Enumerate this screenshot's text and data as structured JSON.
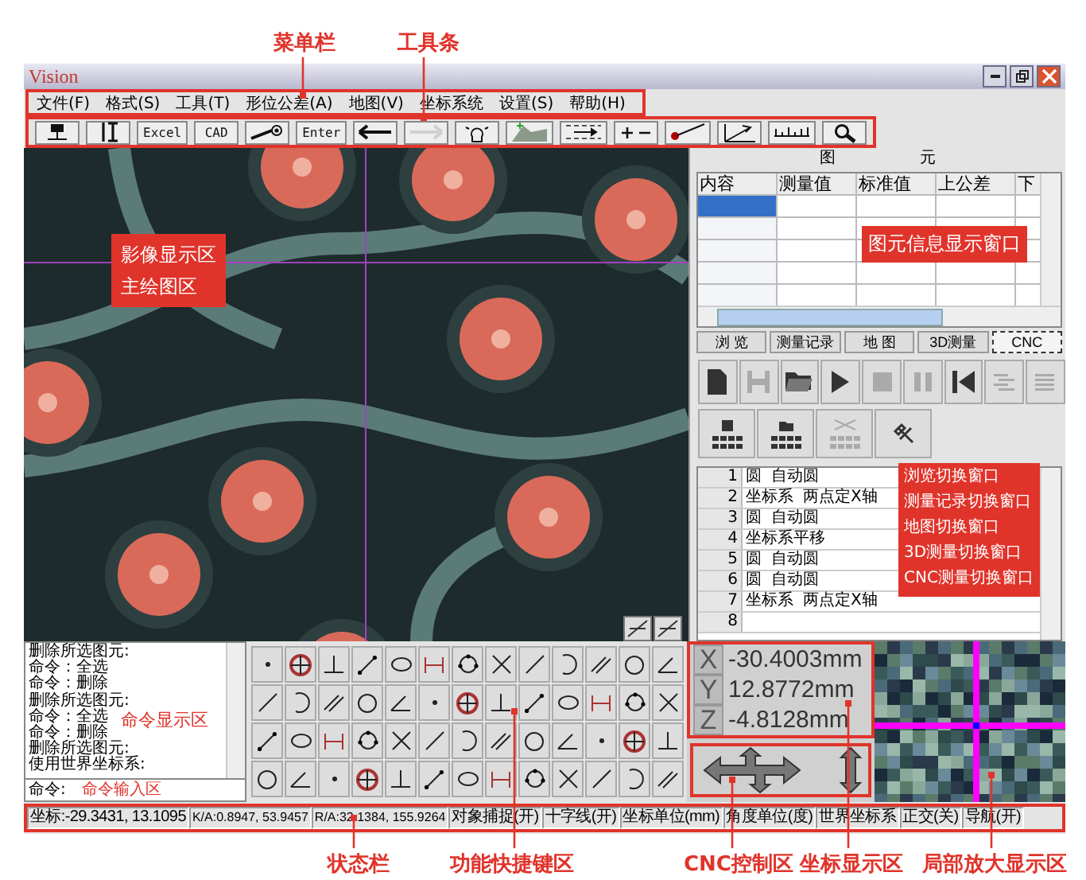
{
  "window": {
    "title": "Vision"
  },
  "menu_bar": {
    "items": [
      "文件(F)",
      "格式(S)",
      "工具(T)",
      "形位公差(A)",
      "地图(V)",
      "坐标系统",
      "设置(S)",
      "帮助(H)"
    ]
  },
  "toolbar": {
    "items": [
      {
        "kind": "icon",
        "disabled": false
      },
      {
        "kind": "icon",
        "disabled": false
      },
      {
        "kind": "text",
        "label": "Excel",
        "disabled": false
      },
      {
        "kind": "text",
        "label": "CAD",
        "disabled": false
      },
      {
        "kind": "icon",
        "disabled": false
      },
      {
        "kind": "text",
        "label": "Enter",
        "disabled": false
      },
      {
        "kind": "icon",
        "disabled": false
      },
      {
        "kind": "icon",
        "disabled": true
      },
      {
        "kind": "icon",
        "disabled": false
      },
      {
        "kind": "icon",
        "disabled": false
      },
      {
        "kind": "icon",
        "disabled": false
      },
      {
        "kind": "icon",
        "disabled": false
      },
      {
        "kind": "icon",
        "disabled": false
      },
      {
        "kind": "icon",
        "disabled": false
      },
      {
        "kind": "icon",
        "disabled": false
      },
      {
        "kind": "icon",
        "disabled": false
      }
    ]
  },
  "image_view": {
    "label_lines": [
      "影像显示区",
      "主绘图区"
    ]
  },
  "element_panel": {
    "title": "图 元",
    "columns": [
      "内容",
      "测量值",
      "标准值",
      "上公差",
      "下"
    ],
    "rows": [
      {
        "selected": true
      },
      {
        "selected": false
      },
      {
        "selected": false
      },
      {
        "selected": false
      },
      {
        "selected": false
      }
    ],
    "label": "图元信息显示窗口"
  },
  "tabs": [
    {
      "label": "浏 览",
      "selected": false
    },
    {
      "label": "测量记录",
      "selected": false
    },
    {
      "label": "地 图",
      "selected": false
    },
    {
      "label": "3D测量",
      "selected": false
    },
    {
      "label": "CNC",
      "selected": true
    }
  ],
  "tab_tools": [
    {
      "disabled": false
    },
    {
      "disabled": true
    },
    {
      "disabled": false
    },
    {
      "disabled": false
    },
    {
      "disabled": true
    },
    {
      "disabled": true
    },
    {
      "disabled": false
    },
    {
      "disabled": true
    },
    {
      "disabled": true
    }
  ],
  "tab_tools_2": [
    {
      "disabled": false
    },
    {
      "disabled": false
    },
    {
      "disabled": true
    },
    {
      "disabled": false
    }
  ],
  "records": [
    {
      "number": "1",
      "type": "圆",
      "name": "自动圆"
    },
    {
      "number": "2",
      "type": "坐标系",
      "name": "两点定X轴"
    },
    {
      "number": "3",
      "type": "圆",
      "name": "自动圆"
    },
    {
      "number": "4",
      "type": "坐标系平移"
    },
    {
      "number": "5",
      "type": "圆",
      "name": "自动圆"
    },
    {
      "number": "6",
      "type": "圆",
      "name": "自动圆"
    },
    {
      "number": "7",
      "type": "坐标系",
      "name": "两点定X轴"
    },
    {
      "number": "8"
    }
  ],
  "records_label_lines": [
    "浏览切换窗口",
    "测量记录切换窗口",
    "地图切换窗口",
    "3D测量切换窗口",
    "CNC测量切换窗口"
  ],
  "command": {
    "lines": [
      "删除所选图元:",
      "命令：全选",
      "命令：删除",
      "删除所选图元:",
      "命令：全选",
      "命令：删除",
      "删除所选图元:",
      "使用世界坐标系:"
    ],
    "display_label": "命令显示区",
    "prompt": "命令:",
    "input_label": "命令输入区"
  },
  "coordinates": [
    {
      "axis": "X",
      "value": "-30.4003mm"
    },
    {
      "axis": "Y",
      "value": "12.8772mm"
    },
    {
      "axis": "Z",
      "value": "-4.8128mm"
    }
  ],
  "status_bar": {
    "fields": [
      "坐标:-29.3431, 13.1095",
      "K/A:0.8947, 53.9457",
      "R/A:32.1384, 155.9264",
      "对象捕捉(开)",
      "十字线(开)",
      "坐标单位(mm)",
      "角度单位(度)",
      "世界坐标系",
      "正交(关)",
      "导航(开)"
    ]
  },
  "callouts": {
    "top": [
      "菜单栏",
      "工具条"
    ],
    "bottom": [
      "状态栏",
      "功能快捷键区",
      "CNC控制区",
      "坐标显示区",
      "局部放大显示区"
    ]
  }
}
